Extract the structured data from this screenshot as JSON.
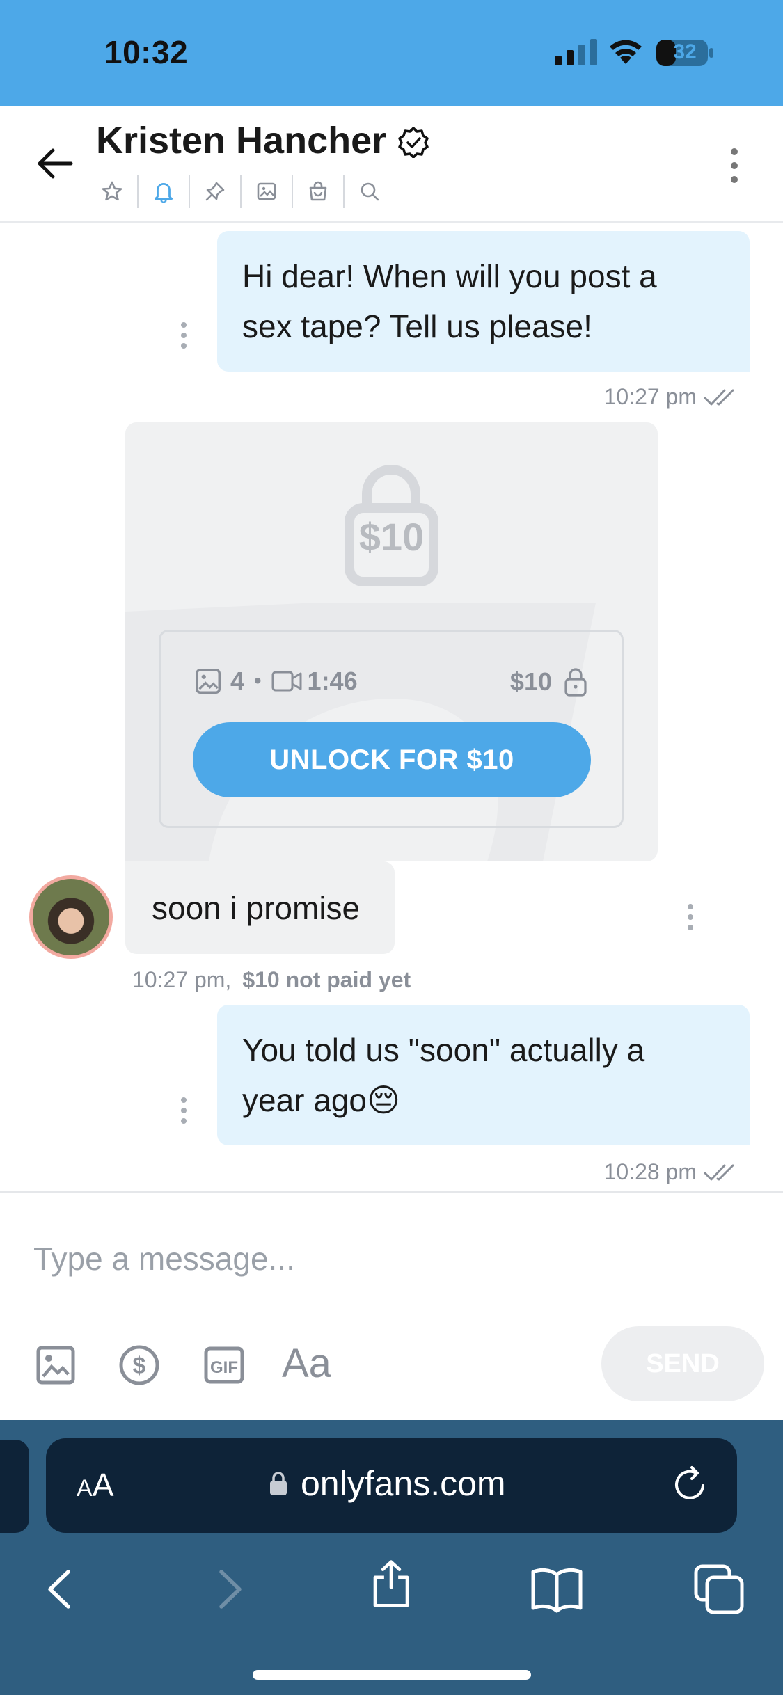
{
  "status_bar": {
    "time": "10:32",
    "battery": "32"
  },
  "header": {
    "title": "Kristen Hancher"
  },
  "messages": [
    {
      "id": "m1",
      "direction": "outgoing",
      "lines": [
        "Hi dear! When will you post a",
        "sex tape? Tell us please!"
      ],
      "time": "10:27 pm"
    },
    {
      "id": "m2",
      "direction": "incoming",
      "ppv": {
        "price_on_lock": "$10",
        "photo_count": "4",
        "dot": "•",
        "video_duration": "1:46",
        "price": "$10",
        "unlock_label": "UNLOCK FOR $10"
      },
      "text": "soon i promise",
      "time": "10:27 pm,",
      "payment_status": "$10 not paid yet"
    },
    {
      "id": "m3",
      "direction": "outgoing",
      "lines": [
        "You told us \"soon\" actually a",
        "year ago😔"
      ],
      "time": "10:28 pm"
    }
  ],
  "composer": {
    "placeholder": "Type a message...",
    "aa_label": "Aa",
    "send_label": "SEND"
  },
  "browser": {
    "aa_small": "A",
    "aa_big": "A",
    "url": "onlyfans.com"
  },
  "colors": {
    "brand_blue": "#4da8e8",
    "outgoing_bubble": "#e3f3fd",
    "incoming_bubble": "#f0f1f2",
    "safari_toolbar": "#2f5e80",
    "address_bar": "#0e2338"
  },
  "icons": [
    "back-arrow-icon",
    "verified-badge-icon",
    "star-icon",
    "bell-icon",
    "pin-icon",
    "image-icon",
    "shopping-bag-icon",
    "search-icon",
    "more-vertical-icon",
    "double-check-icon",
    "lock-icon",
    "video-icon",
    "dollar-circle-icon",
    "gif-icon",
    "reload-icon",
    "share-icon",
    "book-icon",
    "tabs-icon"
  ]
}
